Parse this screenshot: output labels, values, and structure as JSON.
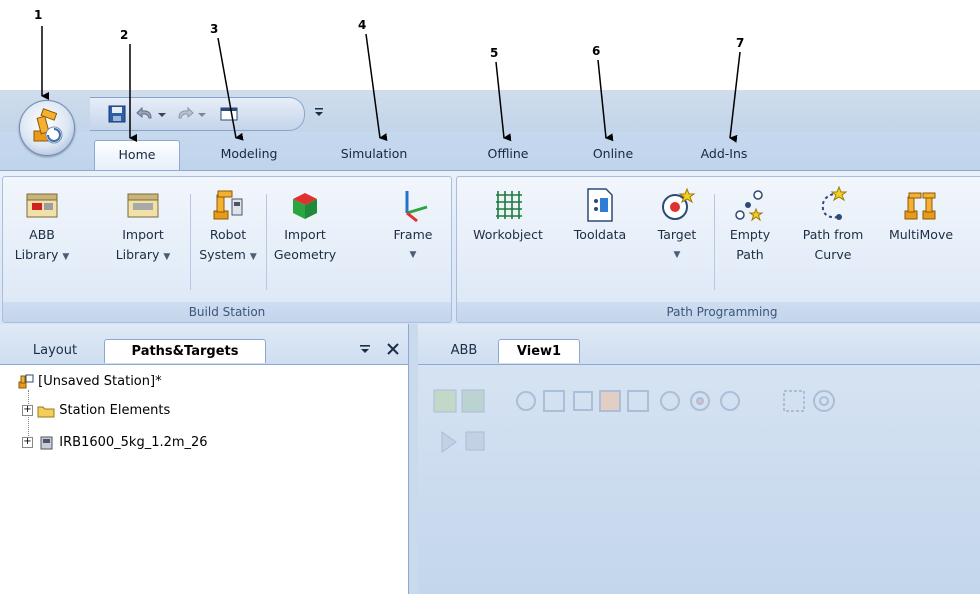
{
  "callouts": [
    "1",
    "2",
    "3",
    "4",
    "5",
    "6",
    "7"
  ],
  "quick_access": {
    "save_icon": "save-icon",
    "undo_icon": "undo-icon",
    "redo_icon": "redo-icon",
    "screen_icon": "screen-icon"
  },
  "tabs": [
    "Home",
    "Modeling",
    "Simulation",
    "Offline",
    "Online",
    "Add-Ins"
  ],
  "ribbon": {
    "build_station": {
      "label": "Build Station",
      "buttons": [
        {
          "line1": "ABB",
          "line2": "Library"
        },
        {
          "line1": "Import",
          "line2": "Library"
        },
        {
          "line1": "Robot",
          "line2": "System"
        },
        {
          "line1": "Import",
          "line2": "Geometry"
        },
        {
          "line1": "Frame",
          "line2": ""
        }
      ]
    },
    "path_programming": {
      "label": "Path Programming",
      "buttons": [
        {
          "line1": "Workobject",
          "line2": ""
        },
        {
          "line1": "Tooldata",
          "line2": ""
        },
        {
          "line1": "Target",
          "line2": ""
        },
        {
          "line1": "Empty",
          "line2": "Path"
        },
        {
          "line1": "Path from",
          "line2": "Curve"
        },
        {
          "line1": "MultiMove",
          "line2": ""
        }
      ]
    }
  },
  "left_panel": {
    "tabs": [
      "Layout",
      "Paths&Targets"
    ],
    "tree": {
      "root": "[Unsaved Station]*",
      "items": [
        "Station Elements",
        "IRB1600_5kg_1.2m_26"
      ]
    }
  },
  "right_panel": {
    "tabs": [
      "ABB",
      "View1"
    ]
  },
  "colors": {
    "ribbon_bg": "#d7e4f4",
    "accent": "#8ea9cf",
    "robot_orange": "#f0a020"
  }
}
